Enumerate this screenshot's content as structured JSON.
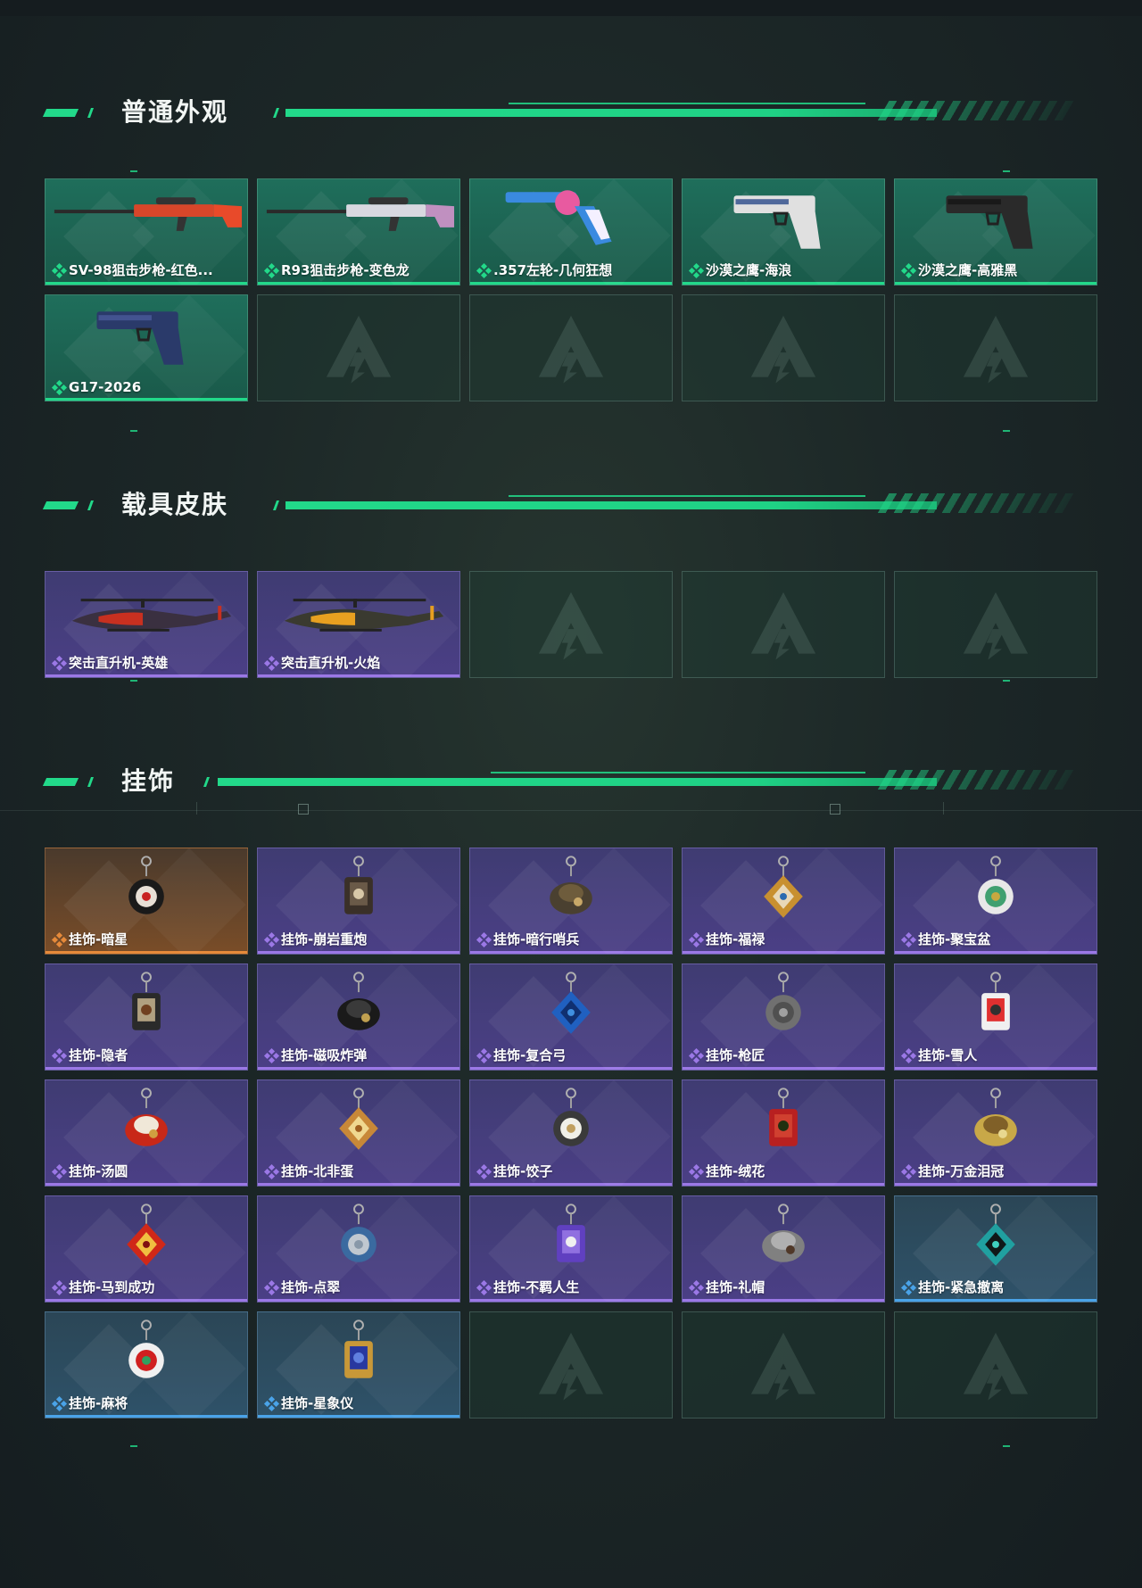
{
  "sections": [
    {
      "title": "普通外观"
    },
    {
      "title": "载具皮肤"
    },
    {
      "title": "挂饰"
    }
  ],
  "weapon_skins": [
    {
      "label": "SV-98狙击步枪-红色...",
      "rarity": "green",
      "icon": "sniper-rifle-icon"
    },
    {
      "label": "R93狙击步枪-变色龙",
      "rarity": "green",
      "icon": "sniper-rifle-icon"
    },
    {
      "label": ".357左轮-几何狂想",
      "rarity": "green",
      "icon": "revolver-icon"
    },
    {
      "label": "沙漠之鹰-海浪",
      "rarity": "green",
      "icon": "pistol-icon"
    },
    {
      "label": "沙漠之鹰-高雅黑",
      "rarity": "green",
      "icon": "pistol-icon"
    },
    {
      "label": "G17-2026",
      "rarity": "green",
      "icon": "pistol-icon"
    }
  ],
  "vehicle_skins": [
    {
      "label": "突击直升机-英雄",
      "rarity": "purple",
      "icon": "helicopter-icon"
    },
    {
      "label": "突击直升机-火焰",
      "rarity": "purple",
      "icon": "helicopter-icon"
    }
  ],
  "charms": [
    {
      "label": "挂饰-暗星",
      "rarity": "orange",
      "icon": "charm-icon"
    },
    {
      "label": "挂饰-崩岩重炮",
      "rarity": "purple",
      "icon": "charm-icon"
    },
    {
      "label": "挂饰-暗行哨兵",
      "rarity": "purple",
      "icon": "charm-icon"
    },
    {
      "label": "挂饰-福禄",
      "rarity": "purple",
      "icon": "charm-icon"
    },
    {
      "label": "挂饰-聚宝盆",
      "rarity": "purple",
      "icon": "charm-icon"
    },
    {
      "label": "挂饰-隐者",
      "rarity": "purple",
      "icon": "charm-icon"
    },
    {
      "label": "挂饰-磁吸炸弹",
      "rarity": "purple",
      "icon": "charm-icon"
    },
    {
      "label": "挂饰-复合弓",
      "rarity": "purple",
      "icon": "charm-icon"
    },
    {
      "label": "挂饰-枪匠",
      "rarity": "purple",
      "icon": "charm-icon"
    },
    {
      "label": "挂饰-雪人",
      "rarity": "purple",
      "icon": "charm-icon"
    },
    {
      "label": "挂饰-汤圆",
      "rarity": "purple",
      "icon": "charm-icon"
    },
    {
      "label": "挂饰-北非蛋",
      "rarity": "purple",
      "icon": "charm-icon"
    },
    {
      "label": "挂饰-饺子",
      "rarity": "purple",
      "icon": "charm-icon"
    },
    {
      "label": "挂饰-绒花",
      "rarity": "purple",
      "icon": "charm-icon"
    },
    {
      "label": "挂饰-万金泪冠",
      "rarity": "purple",
      "icon": "charm-icon"
    },
    {
      "label": "挂饰-马到成功",
      "rarity": "purple",
      "icon": "charm-icon"
    },
    {
      "label": "挂饰-点翠",
      "rarity": "purple",
      "icon": "charm-icon"
    },
    {
      "label": "挂饰-不羁人生",
      "rarity": "purple",
      "icon": "charm-icon"
    },
    {
      "label": "挂饰-礼帽",
      "rarity": "purple",
      "icon": "charm-icon"
    },
    {
      "label": "挂饰-紧急撤离",
      "rarity": "blue",
      "icon": "charm-icon"
    },
    {
      "label": "挂饰-麻将",
      "rarity": "blue",
      "icon": "charm-icon"
    },
    {
      "label": "挂饰-星象仪",
      "rarity": "blue",
      "icon": "charm-icon"
    }
  ],
  "empty_slots": {
    "weapon_skins": 4,
    "vehicle_skins": 3,
    "charms": 3
  },
  "colors": {
    "accent": "#22d98a",
    "green": "#22d98a",
    "purple": "#9b78e6",
    "orange": "#e68a3a",
    "blue": "#4aa3e8"
  }
}
